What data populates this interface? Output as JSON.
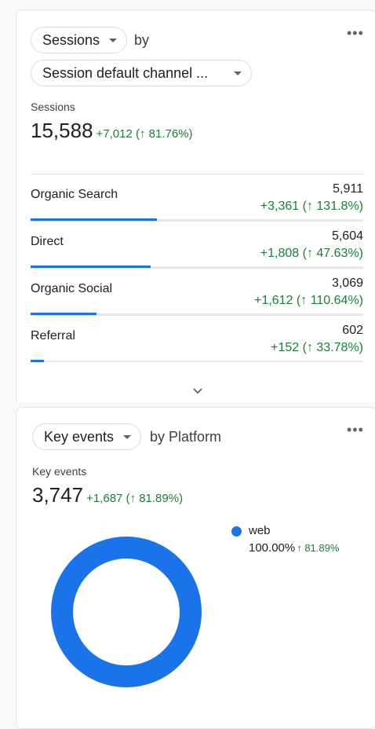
{
  "sessions_card": {
    "metric_dropdown": "Sessions",
    "by_text": "by",
    "dimension_dropdown": "Session default channel ...",
    "metric_label": "Sessions",
    "total": "15,588",
    "total_delta": "+7,012 (↑ 81.76%)",
    "rows": [
      {
        "name": "Organic Search",
        "value": "5,911",
        "delta": "+3,361 (↑ 131.8%)",
        "share": 0.379
      },
      {
        "name": "Direct",
        "value": "5,604",
        "delta": "+1,808 (↑ 47.63%)",
        "share": 0.36
      },
      {
        "name": "Organic Social",
        "value": "3,069",
        "delta": "+1,612 (↑ 110.64%)",
        "share": 0.197
      },
      {
        "name": "Referral",
        "value": "602",
        "delta": "+152 (↑ 33.78%)",
        "share": 0.039
      }
    ]
  },
  "key_events_card": {
    "metric_dropdown": "Key events",
    "by_text": "by Platform",
    "metric_label": "Key events",
    "total": "3,747",
    "total_delta": "+1,687 (↑ 81.89%)",
    "legend": {
      "name": "web",
      "percent": "100.00%",
      "delta": "↑ 81.89%"
    }
  },
  "chart_data": {
    "type": "pie",
    "categories": [
      "web"
    ],
    "values": [
      100.0
    ],
    "title": "",
    "colors": [
      "#1a73e8"
    ]
  },
  "colors": {
    "accent": "#1a73e8",
    "positive": "#188038"
  },
  "icons": {
    "menu": "more-vert-icon",
    "expand": "chevron-down-icon"
  }
}
